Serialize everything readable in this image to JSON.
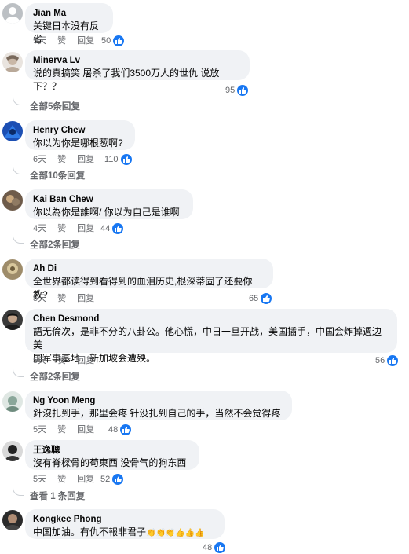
{
  "actions": {
    "time_5d": "5天",
    "time_6d": "6天",
    "time_4d": "4天",
    "like": "赞",
    "reply": "回复"
  },
  "comments": [
    {
      "author": "Jian Ma",
      "text": "关键日本没有反省",
      "time": "5天",
      "reactions": "50",
      "replies": ""
    },
    {
      "author": "Minerva Lv",
      "text": "说的真搞笑 屠杀了我们3500万人的世仇 说放下？？",
      "time": "",
      "reactions": "95",
      "replies": "全部5条回复"
    },
    {
      "author": "Henry Chew",
      "text": "你以为你是哪根葱啊?",
      "time": "6天",
      "reactions": "110",
      "replies": "全部10条回复"
    },
    {
      "author": "Kai Ban Chew",
      "text": "你以為你是誰啊/   你以为自己是谁啊",
      "time": "4天",
      "reactions": "44",
      "replies": "全部2条回复"
    },
    {
      "author": "Ah Di",
      "text": "全世界都读得到看得到的血泪历史,根深蒂固了还要你教?",
      "time": "5天",
      "reactions": "65",
      "replies": ""
    },
    {
      "author": "Chen Desmond",
      "text_line1": "語无倫次，是非不分的八卦公。他心慌，中日一旦开战，美国插手，中国会炸掉週边美",
      "text_line2": "国军事基地，新加坡会遭殃。",
      "time": "5天",
      "reactions": "56",
      "replies": "全部2条回复"
    },
    {
      "author": "Ng Yoon Meng",
      "text": "針沒扎到手，那里会疼   针没扎到自己的手，当然不会觉得疼",
      "time": "5天",
      "reactions": "48",
      "replies": ""
    },
    {
      "author": "王逸聰",
      "text": "沒有脊樑骨的苟東西   没骨气的狗东西",
      "time": "5天",
      "reactions": "52",
      "replies": "查看 1 条回复"
    },
    {
      "author": "Kongkee Phong",
      "text": "中国加油。有仇不報非君子",
      "emoji": "👏👏👏👍👍👍",
      "time": "",
      "reactions": "48",
      "replies": ""
    }
  ],
  "colors": {
    "like_blue": "#1877f2",
    "bubble": "#f0f2f5",
    "meta_gray": "#65676b"
  }
}
